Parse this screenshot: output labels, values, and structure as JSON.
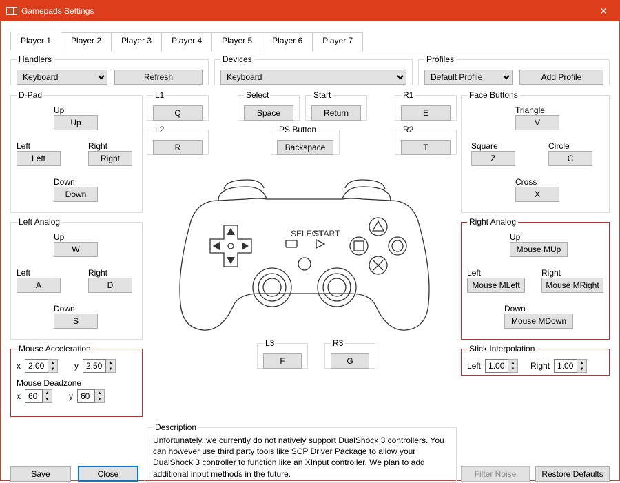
{
  "window": {
    "title": "Gamepads Settings"
  },
  "tabs": [
    "Player 1",
    "Player 2",
    "Player 3",
    "Player 4",
    "Player 5",
    "Player 6",
    "Player 7"
  ],
  "activeTab": 0,
  "handlers": {
    "legend": "Handlers",
    "value": "Keyboard",
    "refresh": "Refresh"
  },
  "devices": {
    "legend": "Devices",
    "value": "Keyboard"
  },
  "profiles": {
    "legend": "Profiles",
    "value": "Default Profile",
    "add": "Add Profile"
  },
  "dpad": {
    "legend": "D-Pad",
    "up_lbl": "Up",
    "up": "Up",
    "left_lbl": "Left",
    "left": "Left",
    "right_lbl": "Right",
    "right": "Right",
    "down_lbl": "Down",
    "down": "Down"
  },
  "l1": {
    "legend": "L1",
    "val": "Q"
  },
  "l2": {
    "legend": "L2",
    "val": "R"
  },
  "select": {
    "legend": "Select",
    "val": "Space"
  },
  "start": {
    "legend": "Start",
    "val": "Return"
  },
  "psbtn": {
    "legend": "PS Button",
    "val": "Backspace"
  },
  "r1": {
    "legend": "R1",
    "val": "E"
  },
  "r2": {
    "legend": "R2",
    "val": "T"
  },
  "face": {
    "legend": "Face Buttons",
    "triangle_l": "Triangle",
    "triangle": "V",
    "square_l": "Square",
    "square": "Z",
    "circle_l": "Circle",
    "circle": "C",
    "cross_l": "Cross",
    "cross": "X"
  },
  "la": {
    "legend": "Left Analog",
    "up_l": "Up",
    "up": "W",
    "left_l": "Left",
    "left": "A",
    "right_l": "Right",
    "right": "D",
    "down_l": "Down",
    "down": "S"
  },
  "ra": {
    "legend": "Right Analog",
    "up_l": "Up",
    "up": "Mouse MUp",
    "left_l": "Left",
    "left": "Mouse MLeft",
    "right_l": "Right",
    "right": "Mouse MRight",
    "down_l": "Down",
    "down": "Mouse MDown"
  },
  "maccel": {
    "legend": "Mouse Acceleration",
    "x_l": "x",
    "x": "2.00",
    "y_l": "y",
    "y": "2.50"
  },
  "mdead": {
    "legend": "Mouse Deadzone",
    "x_l": "x",
    "x": "60",
    "y_l": "y",
    "y": "60"
  },
  "l3": {
    "legend": "L3",
    "val": "F"
  },
  "r3": {
    "legend": "R3",
    "val": "G"
  },
  "stick": {
    "legend": "Stick Interpolation",
    "left_l": "Left",
    "left": "1.00",
    "right_l": "Right",
    "right": "1.00"
  },
  "desc": {
    "legend": "Description",
    "text": "Unfortunately, we currently do not natively support DualShock 3 controllers. You can however use third party tools like SCP Driver Package to allow your DualShock 3 controller to function like an XInput controller. We plan to add additional input methods in the future."
  },
  "bottom": {
    "save": "Save",
    "close": "Close",
    "filter": "Filter Noise",
    "restore": "Restore Defaults"
  },
  "svg": {
    "select": "SELECT",
    "start": "START"
  }
}
